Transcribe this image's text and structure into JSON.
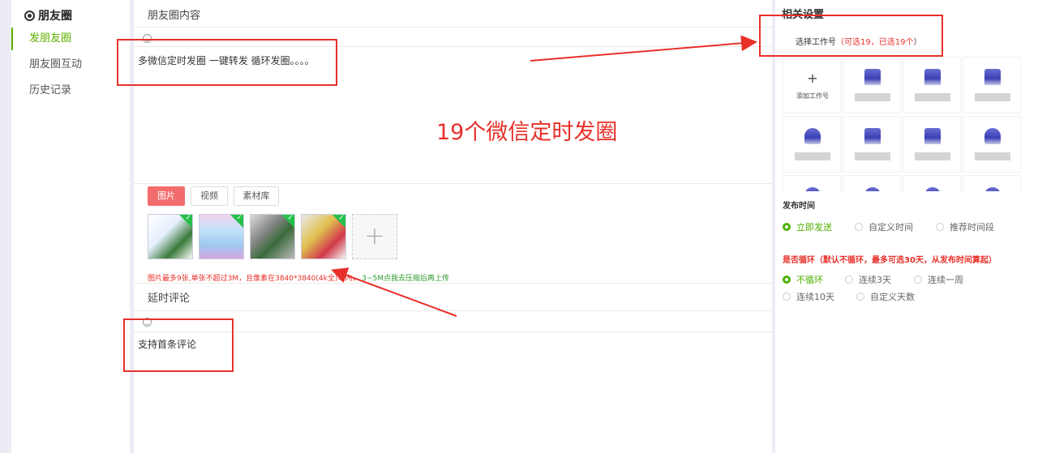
{
  "sidebar": {
    "brand": "朋友圈",
    "items": [
      {
        "label": "发朋友圈",
        "active": true
      },
      {
        "label": "朋友圈互动",
        "active": false
      },
      {
        "label": "历史记录",
        "active": false
      }
    ]
  },
  "main": {
    "content_title": "朋友圈内容",
    "content_text": "多微信定时发圈  一键转发 循环发圈。。。。",
    "overlay_text": "19个微信定时发圈",
    "media_tabs": [
      {
        "label": "图片",
        "active": true
      },
      {
        "label": "视频",
        "active": false
      },
      {
        "label": "素材库",
        "active": false
      }
    ],
    "image_hint_red": "图片最多9张,单张不超过3M，且像素在3840*3840(4k全)以内，",
    "image_hint_green": "3~5M点我去压缩后再上传",
    "comment_title": "延时评论",
    "comment_text": "支持首条评论"
  },
  "settings": {
    "title": "相关设置",
    "choose_label": "选择工作号",
    "choose_limit": "（可选19，已选19个",
    "choose_close": "）",
    "add_account_label": "添加工作号",
    "publish_time_title": "发布时间",
    "publish_options": [
      {
        "label": "立即发送",
        "selected": true
      },
      {
        "label": "自定义时间",
        "selected": false
      },
      {
        "label": "推荐时间段",
        "selected": false
      }
    ],
    "loop_title": "是否循环（默认不循环，最多可选30天，从发布时间算起）",
    "loop_options": [
      {
        "label": "不循环",
        "selected": true
      },
      {
        "label": "连续3天",
        "selected": false
      },
      {
        "label": "连续一周",
        "selected": false
      },
      {
        "label": "连续10天",
        "selected": false
      },
      {
        "label": "自定义天数",
        "selected": false
      }
    ]
  },
  "colors": {
    "accent_green": "#4db000",
    "annotation_red": "#e8302a",
    "tab_active": "#f36c6c"
  }
}
